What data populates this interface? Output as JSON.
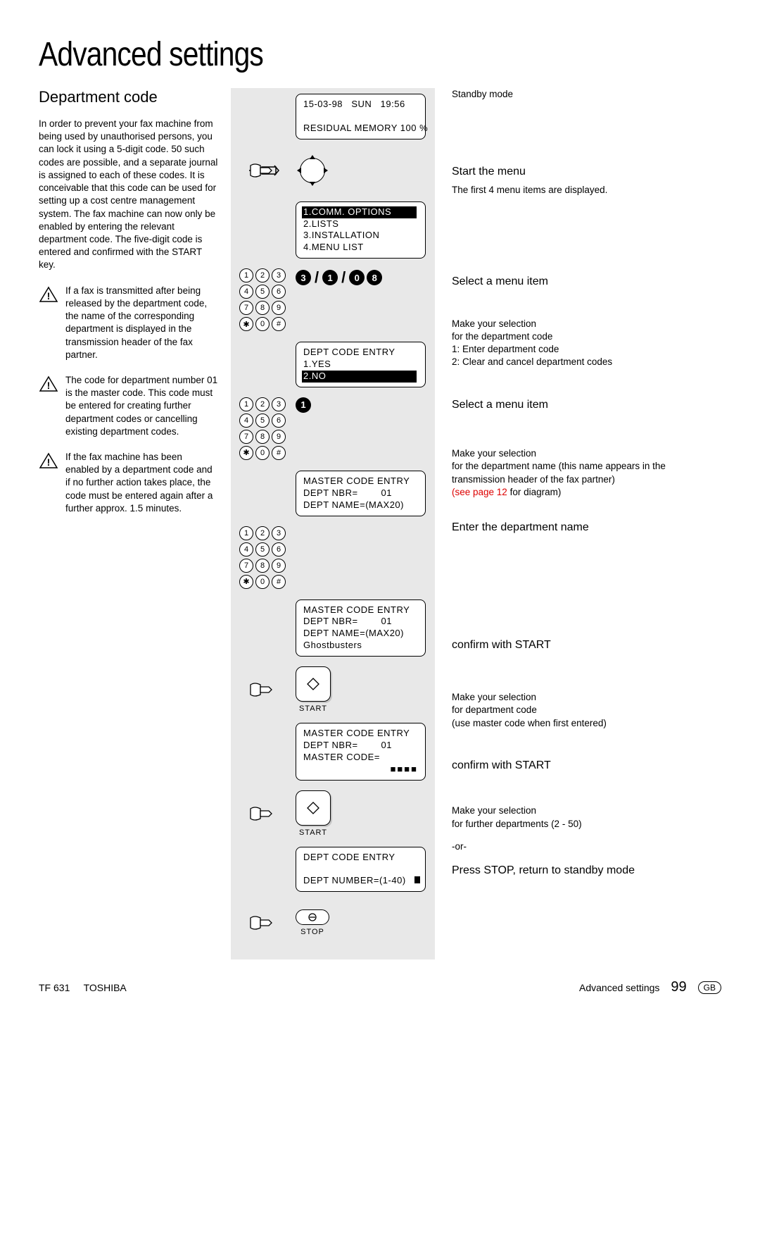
{
  "title": "Advanced settings",
  "subheading": "Department code",
  "intro": "In order to prevent your fax machine from being used by unauthorised persons, you can lock it using a 5-digit code. 50 such codes are possible, and a separate journal is assigned to each of these codes. It is conceivable that this code can be used for setting up a cost centre management system. The fax machine can now only be enabled by entering the relevant department code. The five-digit code is entered and confirmed with the START key.",
  "note1": "If a fax is transmitted after being released by the department code, the name of the corresponding department is displayed in the transmission header of the fax partner.",
  "note2": "The code for department number 01 is the master code. This code must be entered for creating further department codes or cancelling existing department codes.",
  "note3": "If the fax machine has been enabled by a department code and if no further action takes place, the code must be entered again after a further approx. 1.5 minutes.",
  "lcd1": {
    "l1": "15-03-98   SUN   19:56",
    "l2": " ",
    "l3": "RESIDUAL MEMORY 100 %"
  },
  "lcd2": {
    "inv": "1.COMM. OPTIONS",
    "l2": "2.LISTS",
    "l3": "3.INSTALLATION",
    "l4": "4.MENU LIST"
  },
  "lcd3": {
    "l1": "DEPT CODE ENTRY",
    "l2": "1.YES",
    "inv": "2.NO"
  },
  "lcd4": {
    "l1": "MASTER CODE ENTRY",
    "l2": "DEPT NBR=        01",
    "l3": "DEPT NAME=(MAX20)"
  },
  "lcd5": {
    "l1": "MASTER CODE ENTRY",
    "l2": "DEPT NBR=        01",
    "l3": "DEPT NAME=(MAX20)",
    "l4": "Ghostbusters"
  },
  "lcd6": {
    "l1": "MASTER CODE ENTRY",
    "l2": "DEPT NBR=        01",
    "l3": "MASTER CODE="
  },
  "lcd7": {
    "l1": "DEPT CODE ENTRY",
    "l2": " ",
    "l3": "DEPT NUMBER=(1-40)"
  },
  "keyseq1": [
    "3",
    "/",
    "1",
    "/",
    "0",
    "8"
  ],
  "keyseq2": [
    "1"
  ],
  "btn_start": "START",
  "btn_stop": "STOP",
  "right": {
    "standby": "Standby mode",
    "start_menu_h": "Start the menu",
    "start_menu_t": "The first 4 menu items are displayed.",
    "sel1_h": "Select a menu item",
    "sel1_t1": "Make your selection",
    "sel1_t2": "for the department code",
    "sel1_t3": "1: Enter department code",
    "sel1_t4": "2: Clear and cancel department codes",
    "sel2_h": "Select a menu item",
    "sel2_t1": "Make your selection",
    "sel2_t2": "for the department name (this name appears in the transmission header of the fax partner)",
    "sel2_link": "(see page 12",
    "sel2_link2": " for diagram)",
    "enter_h": "Enter the department name",
    "conf1_h": "confirm with START",
    "conf1_t1": "Make your selection",
    "conf1_t2": "for department code",
    "conf1_t3": "(use master code when first entered)",
    "conf2_h": "confirm with START",
    "conf2_t1": "Make your selection",
    "conf2_t2": "for further departments (2 - 50)",
    "or": "-or-",
    "stop_h": "Press STOP, return to standby mode"
  },
  "footer": {
    "left1": "TF 631",
    "left2": "TOSHIBA",
    "right1": "Advanced settings",
    "page": "99",
    "gb": "GB"
  }
}
